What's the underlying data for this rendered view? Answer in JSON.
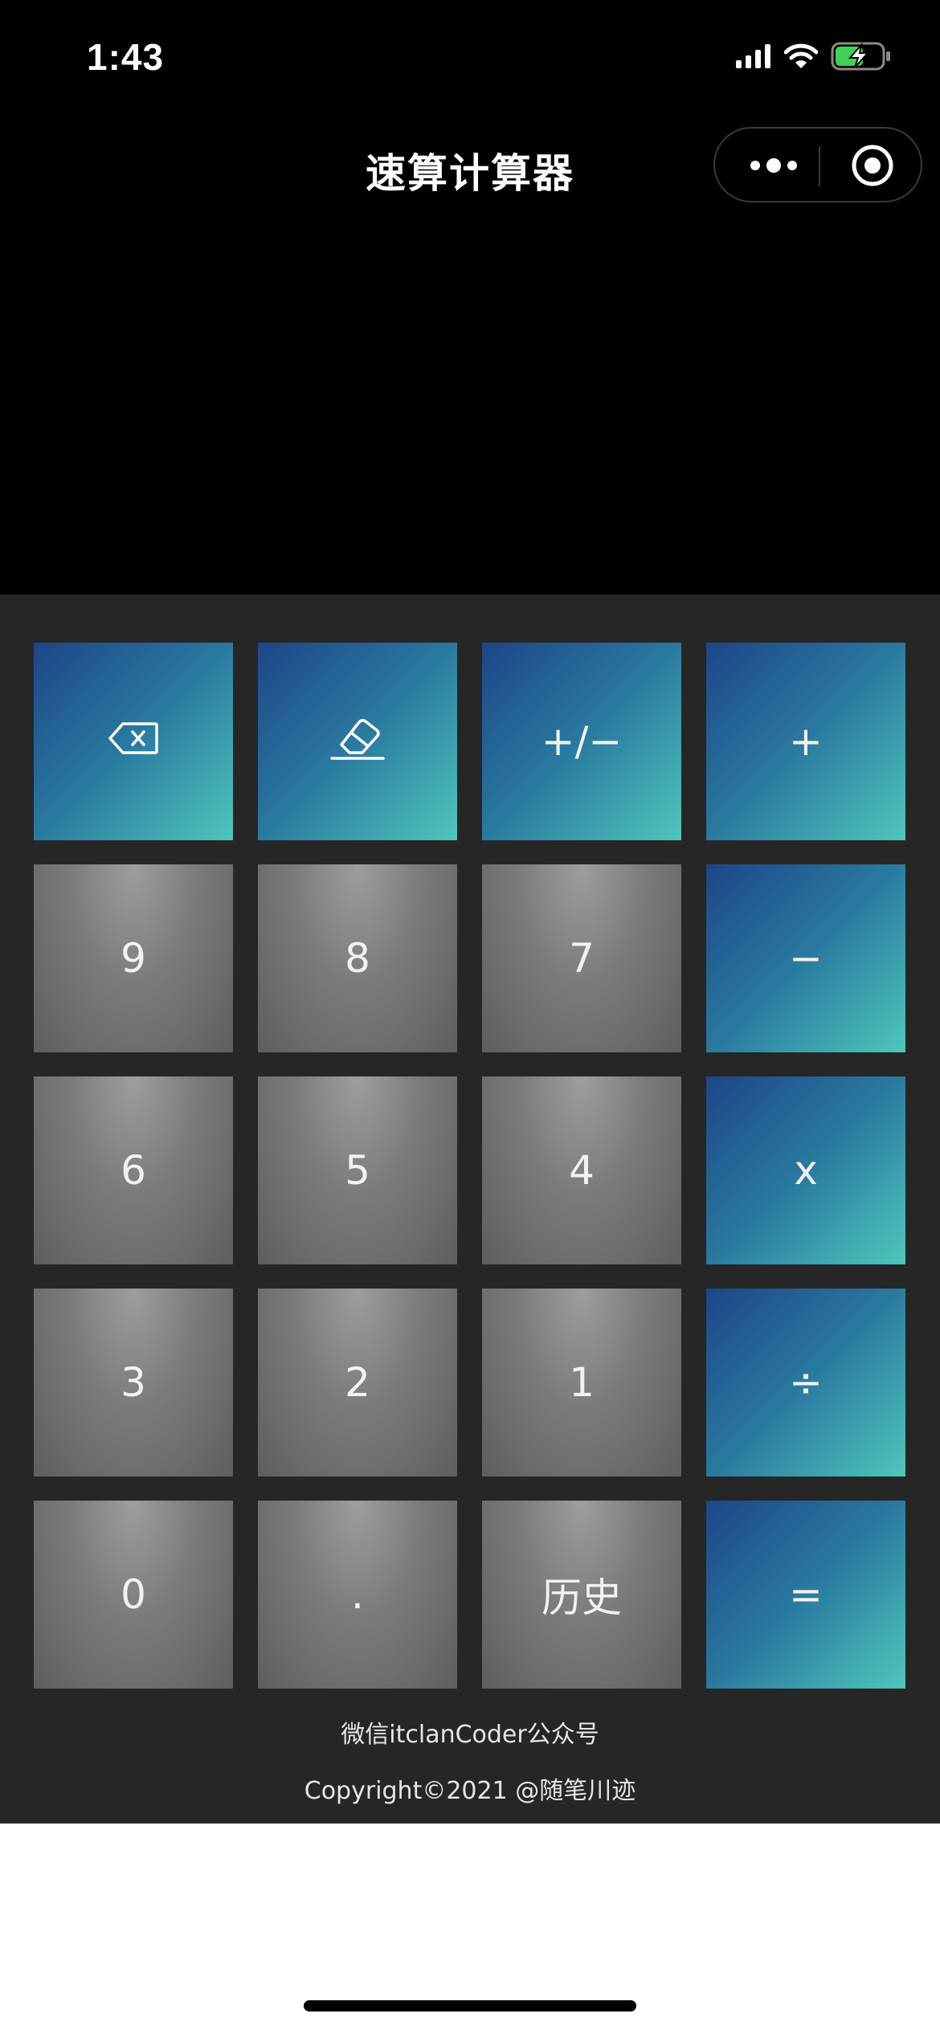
{
  "status_bar": {
    "time": "1:43"
  },
  "nav": {
    "title": "速算计算器",
    "more_icon": "more-dots-icon",
    "close_icon": "mini-program-close-icon"
  },
  "keys": {
    "backspace_icon": "backspace-icon",
    "clear_icon": "eraser-icon",
    "negate": "+/−",
    "plus": "+",
    "nine": "9",
    "eight": "8",
    "seven": "7",
    "minus": "−",
    "six": "6",
    "five": "5",
    "four": "4",
    "multiply": "x",
    "three": "3",
    "two": "2",
    "one": "1",
    "divide": "÷",
    "zero": "0",
    "dot": ".",
    "history": "历史",
    "equals": "="
  },
  "footer": {
    "line1": "微信itclanCoder公众号",
    "line2": "Copyright©2021 @随笔川迹"
  },
  "colors": {
    "op_start": "#1d4687",
    "op_end": "#4ec7bb",
    "num_key": "#7b7b7b",
    "pad_bg": "#262626",
    "display_bg": "#000000"
  }
}
